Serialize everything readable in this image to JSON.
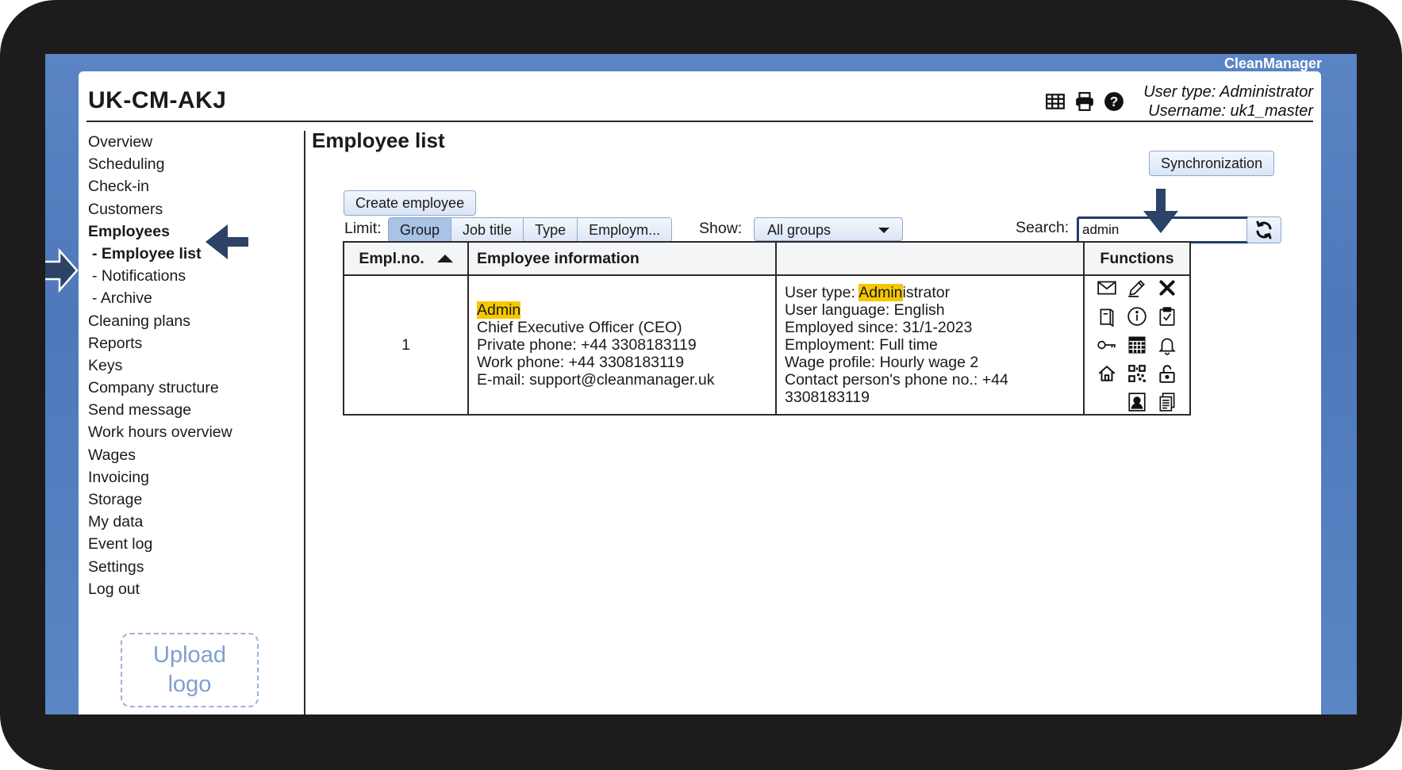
{
  "app": {
    "brand": "CleanManager",
    "site_title": "UK-CM-AKJ"
  },
  "header": {
    "tools": [
      "table-icon",
      "printer-icon",
      "help-icon"
    ],
    "user_type": "User type: Administrator",
    "username": "Username: uk1_master"
  },
  "sidebar": {
    "items": [
      {
        "label": "Overview"
      },
      {
        "label": "Scheduling"
      },
      {
        "label": "Check-in"
      },
      {
        "label": "Customers"
      },
      {
        "label": "Employees"
      },
      {
        "label": "- Employee list"
      },
      {
        "label": "- Notifications"
      },
      {
        "label": "- Archive"
      },
      {
        "label": "Cleaning plans"
      },
      {
        "label": "Reports"
      },
      {
        "label": "Keys"
      },
      {
        "label": "Company structure"
      },
      {
        "label": "Send message"
      },
      {
        "label": "Work hours overview"
      },
      {
        "label": "Wages"
      },
      {
        "label": "Invoicing"
      },
      {
        "label": "Storage"
      },
      {
        "label": "My data"
      },
      {
        "label": "Event log"
      },
      {
        "label": "Settings"
      },
      {
        "label": "Log out"
      }
    ],
    "upload_logo": "Upload logo"
  },
  "main": {
    "title": "Employee list",
    "sync_label": "Synchronization",
    "create_label": "Create employee",
    "limit_label": "Limit:",
    "limit_options": [
      "Group",
      "Job title",
      "Type",
      "Employm..."
    ],
    "limit_selected": "Group",
    "show_label": "Show:",
    "show_value": "All groups",
    "search_label": "Search:",
    "search_value": "admin"
  },
  "table": {
    "headers": {
      "empl_no": "Empl.no.",
      "info": "Employee information",
      "extra": "",
      "functions": "Functions"
    },
    "rows": [
      {
        "empl_no": "1",
        "name": "Admin",
        "job_title": "Chief Executive Officer (CEO)",
        "private_phone": "Private phone: +44 3308183119",
        "work_phone": "Work phone: +44 3308183119",
        "email": "E-mail: support@cleanmanager.uk",
        "user_type_prefix": "User type: ",
        "user_type_match": "Admin",
        "user_type_rest": "istrator",
        "user_language": "User language: English",
        "employed_since": "Employed since: 31/1-2023",
        "employment": "Employment: Full time",
        "wage_profile": "Wage profile: Hourly wage 2",
        "contact_phone": "Contact person's phone no.: +44 3308183119",
        "function_icons": [
          "mail-icon",
          "edit-icon",
          "delete-icon",
          "book-icon",
          "info-icon",
          "clipboard-check-icon",
          "key-icon",
          "calendar-icon",
          "bell-icon",
          "home-icon",
          "qr-code-icon",
          "unlock-icon",
          "id-card-icon",
          "documents-icon"
        ]
      }
    ]
  },
  "colors": {
    "accent": "#1f3c6e",
    "highlight": "#f6c800",
    "screen_bg": "#5b84c4",
    "button_bg": "#dbe6f5"
  }
}
